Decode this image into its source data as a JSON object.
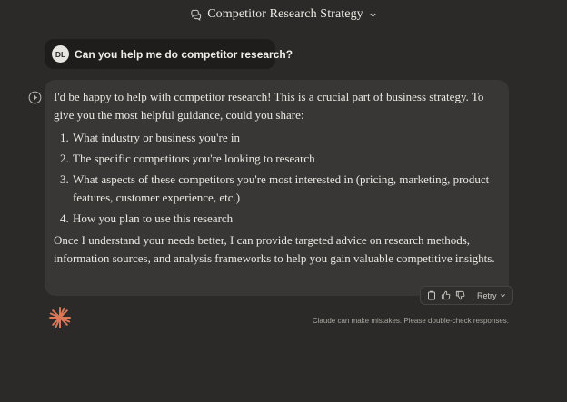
{
  "header": {
    "title": "Competitor Research Strategy",
    "chat_icon": "chat-bubbles-icon",
    "chevron_icon": "chevron-down-icon"
  },
  "user_message": {
    "avatar_initials": "DL",
    "text": "Can you help me do competitor research?"
  },
  "assistant_message": {
    "play_icon": "play-circle-icon",
    "intro": "I'd be happy to help with competitor research! This is a crucial part of business strategy. To give you the most helpful guidance, could you share:",
    "items": [
      "What industry or business you're in",
      "The specific competitors you're looking to research",
      "What aspects of these competitors you're most interested in (pricing, marketing, product features, customer experience, etc.)",
      "How you plan to use this research"
    ],
    "outro": "Once I understand your needs better, I can provide targeted advice on research methods, information sources, and analysis frameworks to help you gain valuable competitive insights."
  },
  "actions": {
    "copy_icon": "copy-icon",
    "thumbs_up_icon": "thumbs-up-icon",
    "thumbs_down_icon": "thumbs-down-icon",
    "retry_label": "Retry"
  },
  "footer": {
    "logo_icon": "spark-logo-icon",
    "disclaimer": "Claude can make mistakes. Please double-check responses."
  },
  "colors": {
    "background": "#2b2a28",
    "user_bubble": "#1e1d1b",
    "assistant_card": "#383735",
    "brand_accent": "#d97757"
  }
}
